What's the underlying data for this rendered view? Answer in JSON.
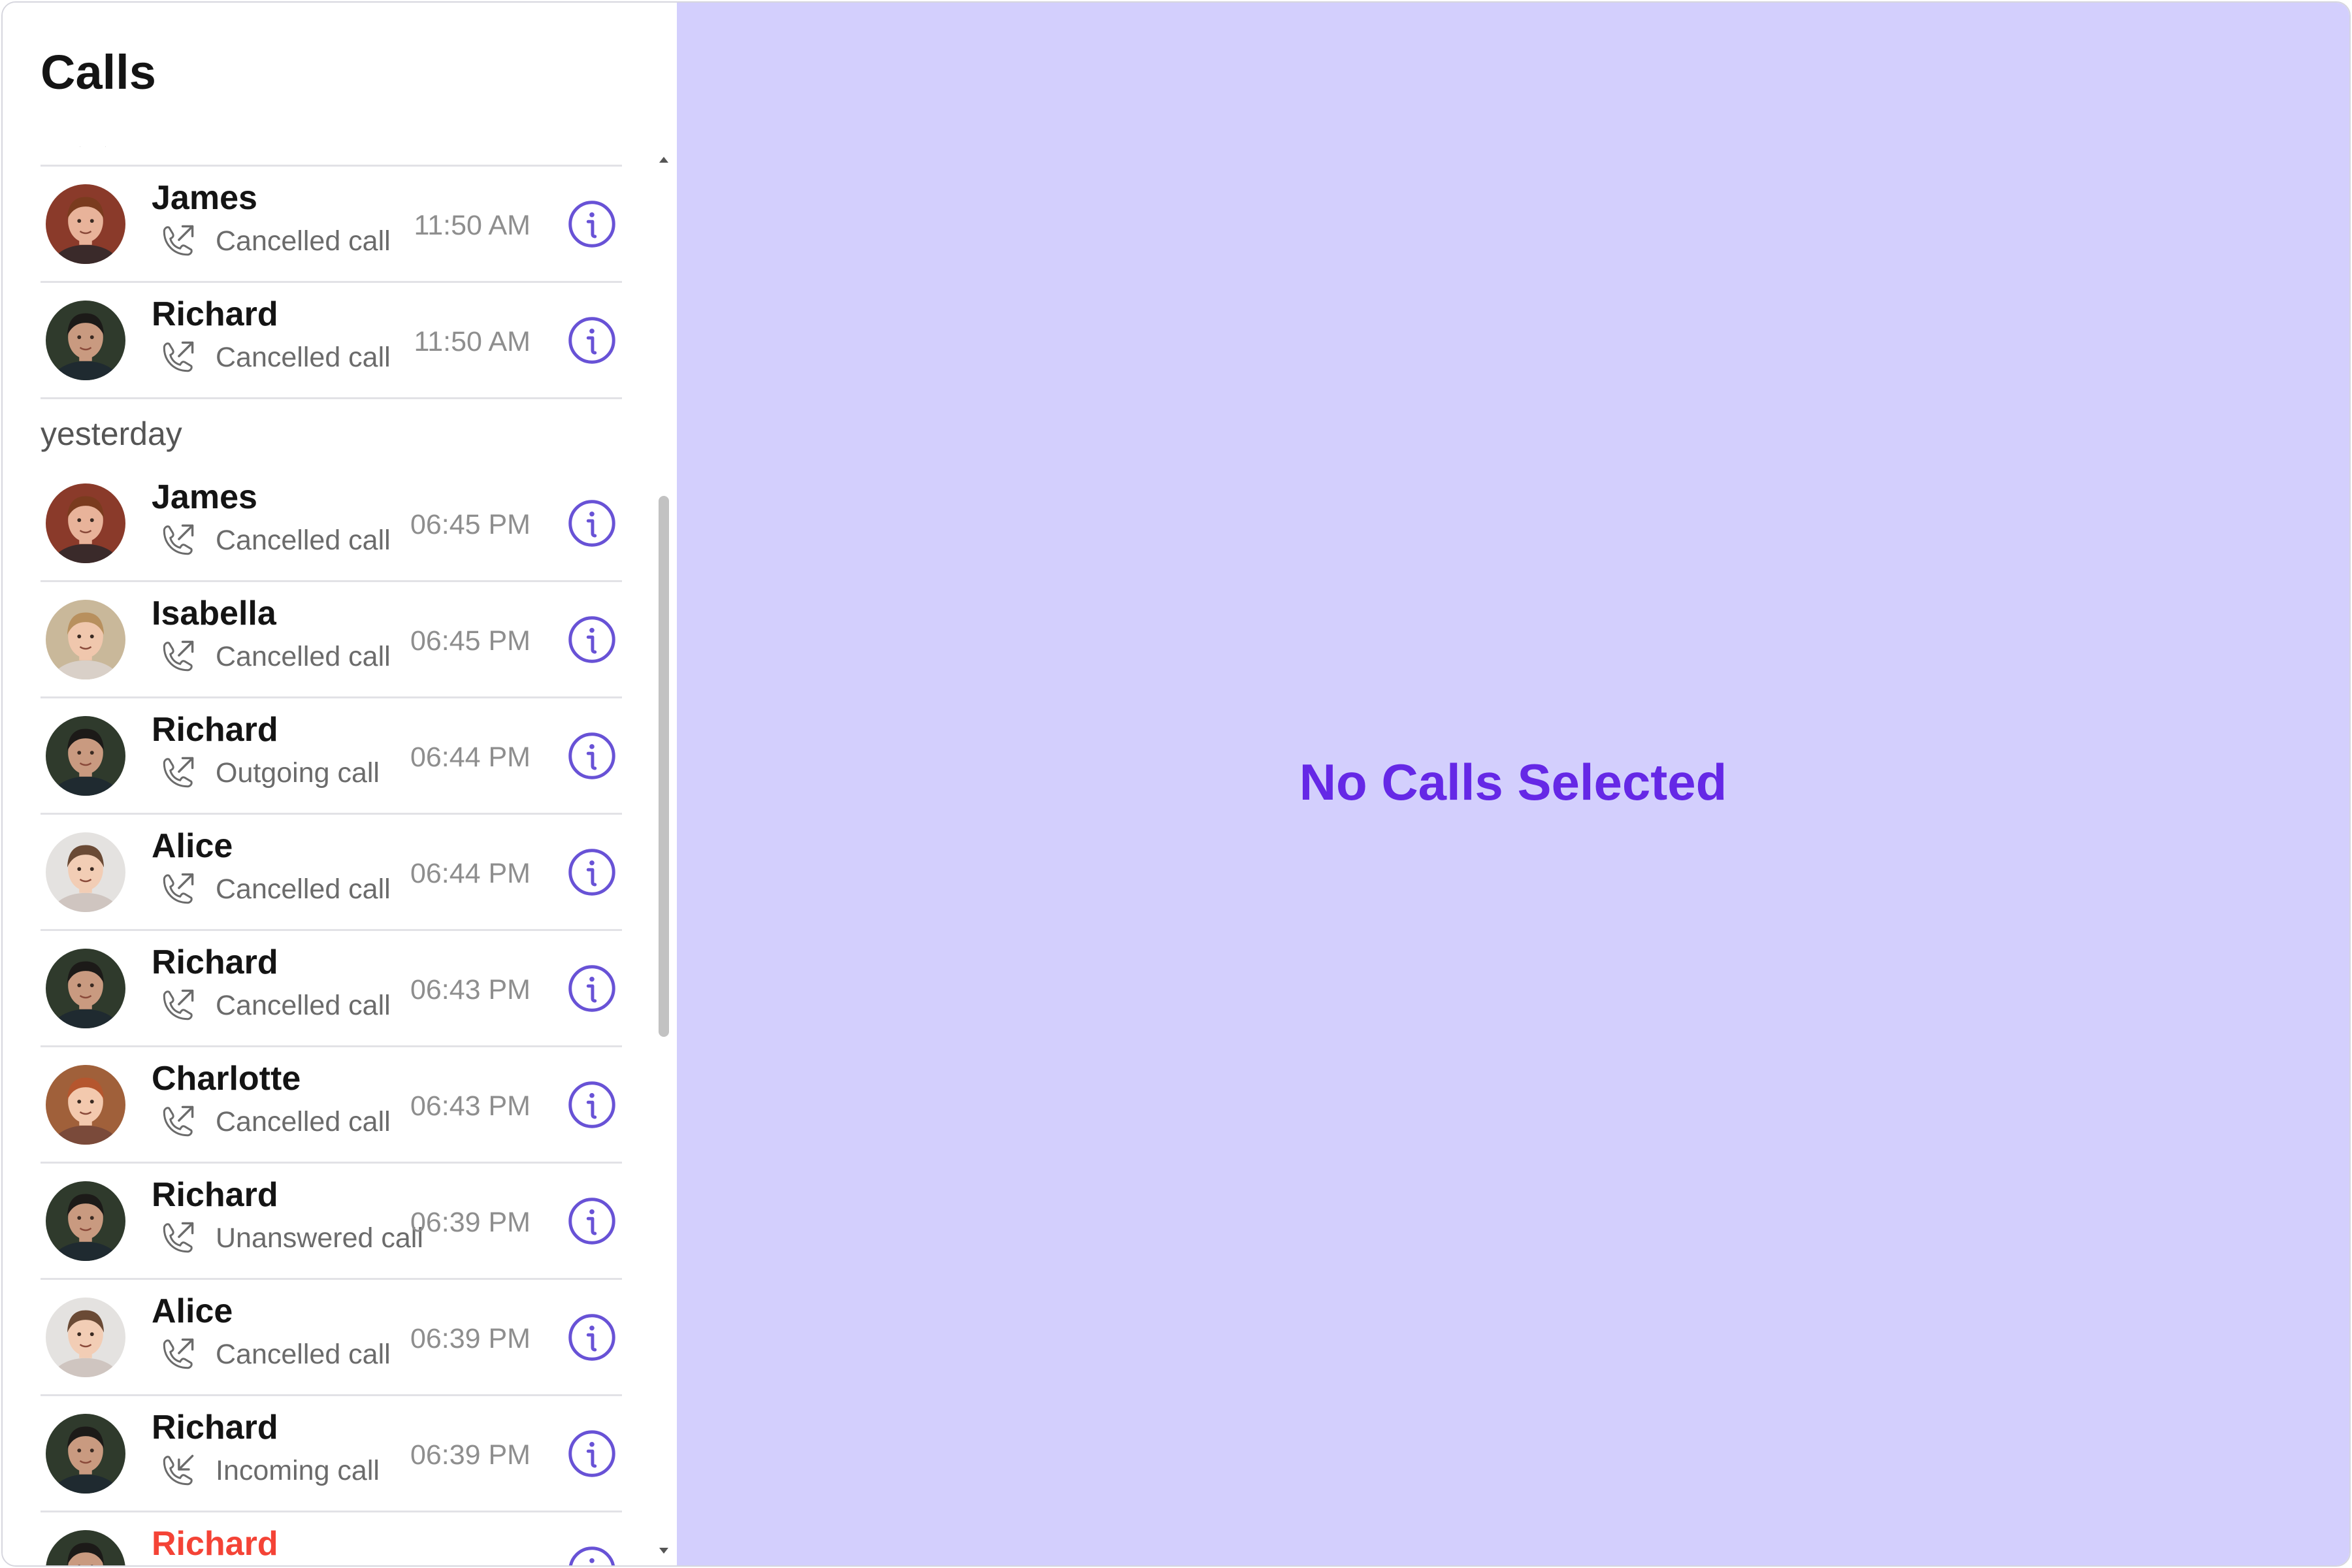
{
  "panel_title": "Calls",
  "empty_state": "No Calls Selected",
  "colors": {
    "accent": "#6528e6",
    "icon_purple": "#6852d6",
    "right_panel_bg": "#d3cffd",
    "missed_red": "#f44336",
    "muted_text": "#8e8e8e"
  },
  "calls_today": [
    {
      "name": "James",
      "status": "Cancelled call",
      "time": "11:50 AM",
      "direction": "outgoing",
      "avatar": "james"
    },
    {
      "name": "Richard",
      "status": "Cancelled call",
      "time": "11:50 AM",
      "direction": "outgoing",
      "avatar": "richard"
    }
  ],
  "section_yesterday": "yesterday",
  "calls_yesterday": [
    {
      "name": "James",
      "status": "Cancelled call",
      "time": "06:45 PM",
      "direction": "outgoing",
      "avatar": "james"
    },
    {
      "name": "Isabella",
      "status": "Cancelled call",
      "time": "06:45 PM",
      "direction": "outgoing",
      "avatar": "isabella"
    },
    {
      "name": "Richard",
      "status": "Outgoing call",
      "time": "06:44 PM",
      "direction": "outgoing",
      "avatar": "richard"
    },
    {
      "name": "Alice",
      "status": "Cancelled call",
      "time": "06:44 PM",
      "direction": "outgoing",
      "avatar": "alice"
    },
    {
      "name": "Richard",
      "status": "Cancelled call",
      "time": "06:43 PM",
      "direction": "outgoing",
      "avatar": "richard"
    },
    {
      "name": "Charlotte",
      "status": "Cancelled call",
      "time": "06:43 PM",
      "direction": "outgoing",
      "avatar": "charlotte"
    },
    {
      "name": "Richard",
      "status": "Unanswered call",
      "time": "06:39 PM",
      "direction": "outgoing",
      "avatar": "richard"
    },
    {
      "name": "Alice",
      "status": "Cancelled call",
      "time": "06:39 PM",
      "direction": "outgoing",
      "avatar": "alice"
    },
    {
      "name": "Richard",
      "status": "Incoming call",
      "time": "06:39 PM",
      "direction": "incoming",
      "avatar": "richard"
    },
    {
      "name": "Richard",
      "status": "",
      "time": "",
      "direction": "incoming",
      "avatar": "richard",
      "missed": true
    }
  ]
}
